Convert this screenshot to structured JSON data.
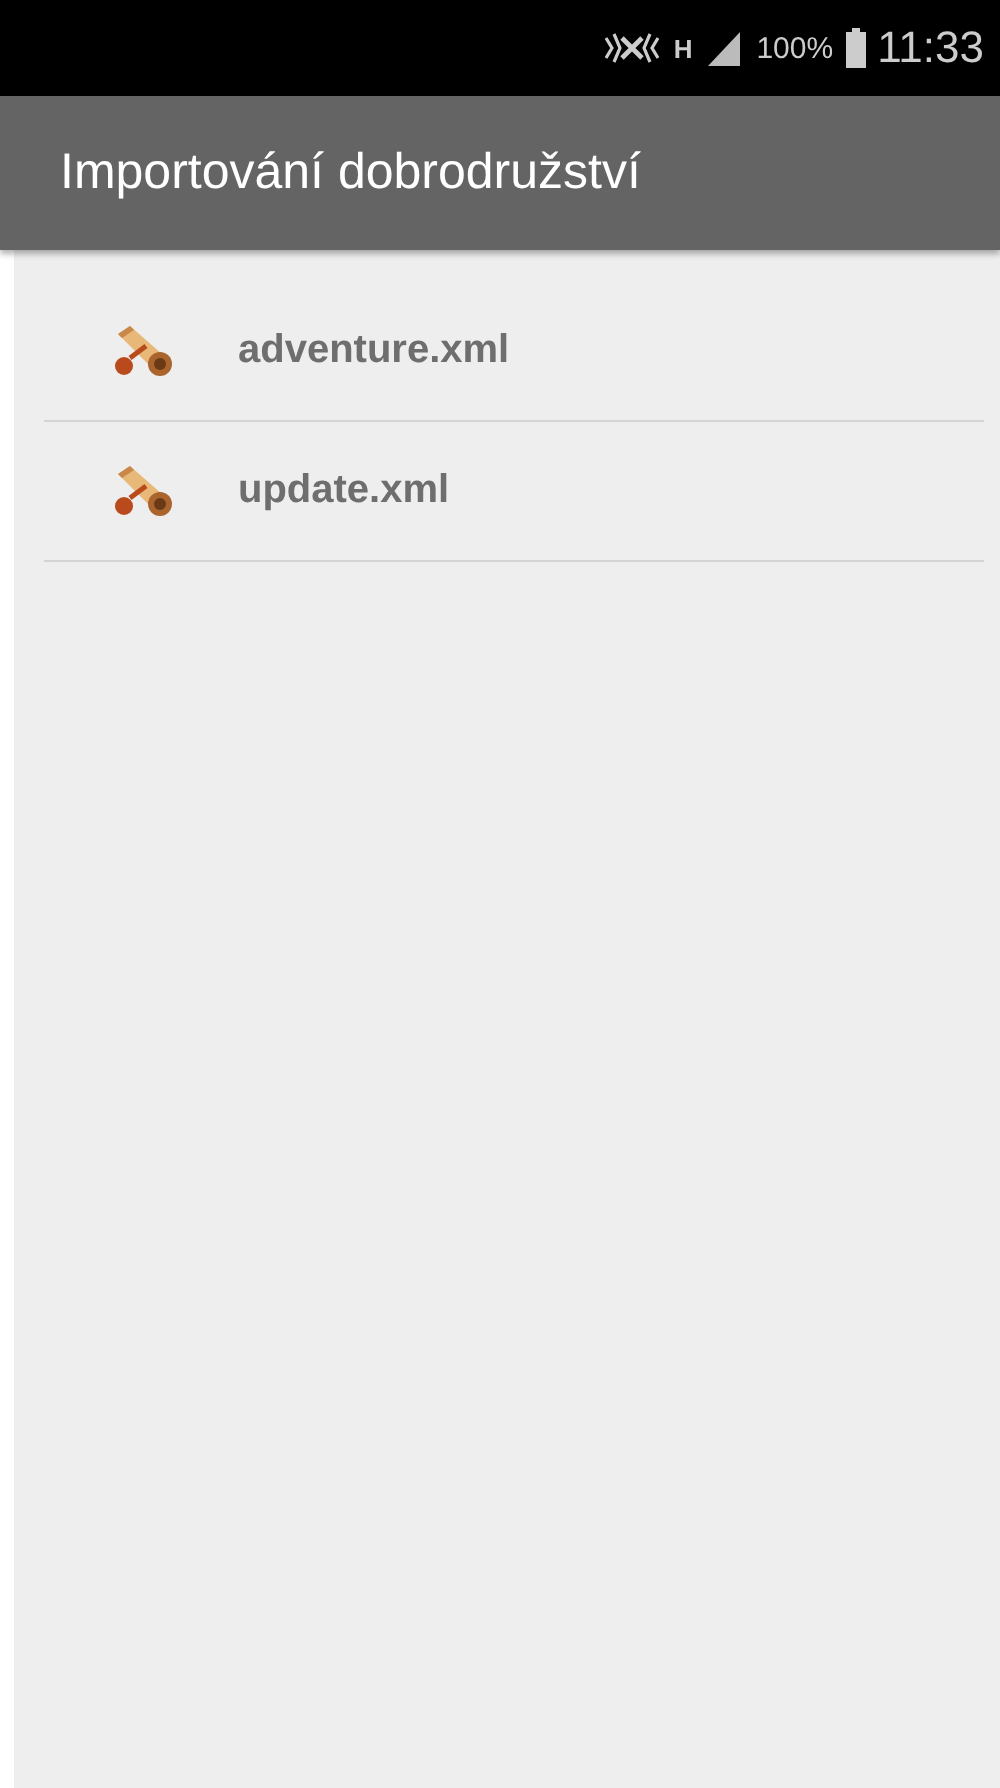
{
  "status_bar": {
    "network_type": "H",
    "battery": "100%",
    "time": "11:33"
  },
  "app_bar": {
    "title": "Importování dobrodružství"
  },
  "files": [
    {
      "name": "adventure.xml"
    },
    {
      "name": "update.xml"
    }
  ]
}
